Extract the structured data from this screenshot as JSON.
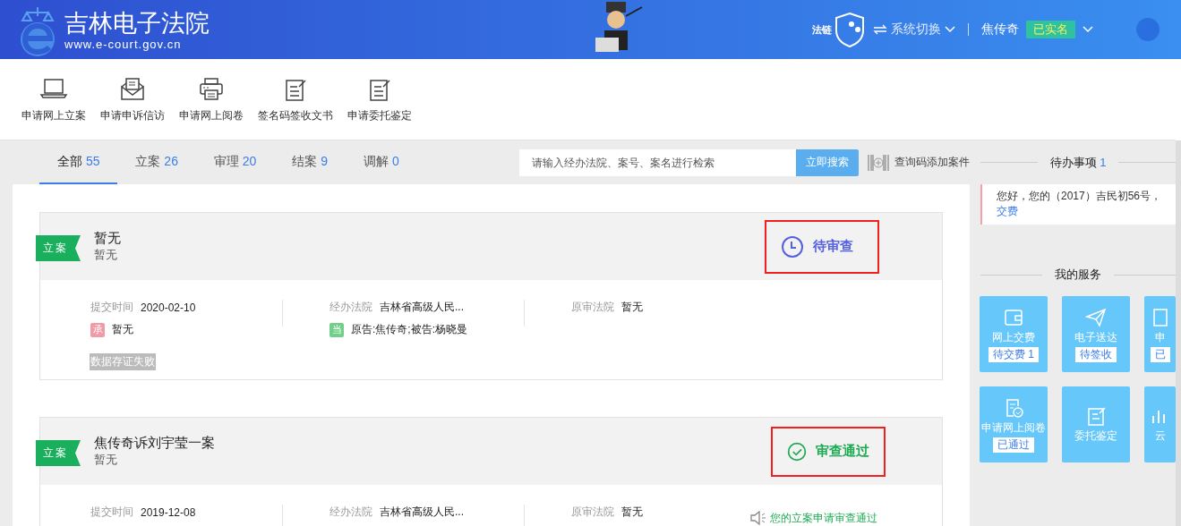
{
  "header": {
    "site_title": "吉林电子法院",
    "site_url": "www.e-court.gov.cn",
    "chain_label": "法链",
    "system_switch": "系统切换",
    "user_name": "焦传奇",
    "verified_badge": "已实名"
  },
  "toolbar": [
    {
      "label": "申请网上立案"
    },
    {
      "label": "申请申诉信访"
    },
    {
      "label": "申请网上阅卷"
    },
    {
      "label": "签名码签收文书"
    },
    {
      "label": "申请委托鉴定"
    }
  ],
  "tabs": [
    {
      "label": "全部",
      "count": "55",
      "selected": true
    },
    {
      "label": "立案",
      "count": "26",
      "selected": false
    },
    {
      "label": "审理",
      "count": "20",
      "selected": false
    },
    {
      "label": "结案",
      "count": "9",
      "selected": false
    },
    {
      "label": "调解",
      "count": "0",
      "selected": false
    }
  ],
  "search": {
    "placeholder": "请输入经办法院、案号、案名进行检索",
    "button": "立即搜索",
    "add_by_code": "查询码添加案件"
  },
  "cases": [
    {
      "stage": "立案",
      "title": "暂无",
      "subtitle": "暂无",
      "status": {
        "kind": "pending",
        "label": "待审查"
      },
      "submit_label": "提交时间",
      "submit_date": "2020-02-10",
      "court_label": "经办法院",
      "court": "吉林省高级人民...",
      "orig_court_label": "原审法院",
      "orig_court": "暂无",
      "judge_mark": "承",
      "judge": "暂无",
      "party_mark": "当",
      "parties": "原告:焦传奇;被告:杨晓曼",
      "failure_tag": "数据存证失败"
    },
    {
      "stage": "立案",
      "title": "焦传奇诉刘宇莹一案",
      "subtitle": "暂无",
      "status": {
        "kind": "approved",
        "label": "审查通过"
      },
      "submit_label": "提交时间",
      "submit_date": "2019-12-08",
      "court_label": "经办法院",
      "court": "吉林省高级人民...",
      "orig_court_label": "原审法院",
      "orig_court": "暂无",
      "notice": "您的立案申请审查通过"
    }
  ],
  "sidebar": {
    "todo_title": "待办事项",
    "todo_count": "1",
    "todo_message": "您好，您的（2017）吉民初56号，",
    "todo_link": "交费",
    "services_title": "我的服务",
    "services": [
      {
        "label": "网上交费",
        "badge": "待交费 1"
      },
      {
        "label": "电子送达",
        "badge": "待签收"
      },
      {
        "label": "申",
        "badge": "已"
      },
      {
        "label": "申请网上阅卷",
        "badge": "已通过"
      },
      {
        "label": "委托鉴定"
      },
      {
        "label": "云"
      }
    ]
  }
}
